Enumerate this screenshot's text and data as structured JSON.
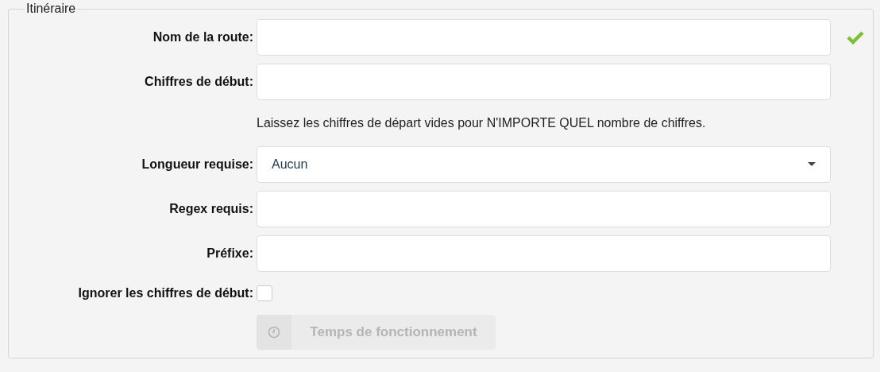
{
  "section": {
    "title": "Itinéraire"
  },
  "rows": [
    {
      "kind": "text",
      "label": "Nom de la route:",
      "valid": true
    },
    {
      "kind": "text",
      "label": "Chiffres de début:",
      "valid": false
    },
    {
      "kind": "help",
      "text": "Laissez les chiffres de départ vides pour N'IMPORTE QUEL nombre de chiffres."
    },
    {
      "kind": "select",
      "label": "Longueur requise:",
      "value": "Aucun"
    },
    {
      "kind": "text",
      "label": "Regex requis:",
      "valid": false
    },
    {
      "kind": "text",
      "label": "Préfixe:",
      "valid": false
    },
    {
      "kind": "checkbox",
      "label": "Ignorer les chiffres de début:",
      "checked": false
    }
  ],
  "button": {
    "label": "Temps de fonctionnement",
    "disabled": true
  }
}
